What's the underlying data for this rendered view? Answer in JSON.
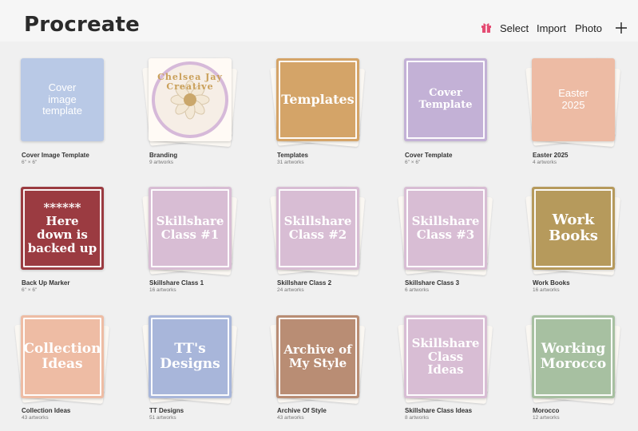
{
  "app": {
    "title": "Procreate"
  },
  "toolbar": {
    "gift_icon": "gift-icon",
    "select_label": "Select",
    "import_label": "Import",
    "photo_label": "Photo",
    "add_icon": "plus-icon"
  },
  "gallery": {
    "items": [
      {
        "name": "Cover Image Template",
        "meta": "6\" × 6\"",
        "cover_text": "Cover\nimage\ntemplate",
        "color": "#b9c9e6",
        "kind": "single"
      },
      {
        "name": "Branding",
        "meta": "9 artworks",
        "cover_text": "Chelsea Jay\nCreative",
        "color": "#f6eee6",
        "kind": "stack"
      },
      {
        "name": "Templates",
        "meta": "31 artworks",
        "cover_text": "Templates",
        "color": "#d4a468",
        "kind": "stack"
      },
      {
        "name": "Cover Template",
        "meta": "6\" × 6\"",
        "cover_text": "Cover\nTemplate",
        "color": "#c3b1d6",
        "kind": "single"
      },
      {
        "name": "Easter 2025",
        "meta": "4 artworks",
        "cover_text": "Easter\n2025",
        "color": "#edbba4",
        "kind": "stack"
      },
      {
        "name": "Back Up Marker",
        "meta": "6\" × 6\"",
        "cover_text": "******\nHere\ndown is\nbacked up",
        "color": "#9b3b41",
        "kind": "single"
      },
      {
        "name": "Skillshare Class 1",
        "meta": "16 artworks",
        "cover_text": "Skillshare\nClass #1",
        "color": "#d8bdd4",
        "kind": "stack"
      },
      {
        "name": "Skillshare Class 2",
        "meta": "24 artworks",
        "cover_text": "Skillshare\nClass #2",
        "color": "#d8bdd4",
        "kind": "stack"
      },
      {
        "name": "Skillshare Class 3",
        "meta": "6 artworks",
        "cover_text": "Skillshare\nClass #3",
        "color": "#d8bdd4",
        "kind": "stack"
      },
      {
        "name": "Work Books",
        "meta": "16 artworks",
        "cover_text": "Work\nBooks",
        "color": "#b69a5c",
        "kind": "stack"
      },
      {
        "name": "Collection Ideas",
        "meta": "43 artworks",
        "cover_text": "Collection\nIdeas",
        "color": "#eebca4",
        "kind": "stack"
      },
      {
        "name": "TT Designs",
        "meta": "51 artworks",
        "cover_text": "TT's\nDesigns",
        "color": "#a8b6da",
        "kind": "stack"
      },
      {
        "name": "Archive Of Style",
        "meta": "43 artworks",
        "cover_text": "Archive of\nMy Style",
        "color": "#b98d74",
        "kind": "stack"
      },
      {
        "name": "Skillshare Class Ideas",
        "meta": "8 artworks",
        "cover_text": "Skillshare\nClass\nIdeas",
        "color": "#d8bdd4",
        "kind": "stack"
      },
      {
        "name": "Morocco",
        "meta": "12 artworks",
        "cover_text": "Working\nMorocco",
        "color": "#a7c0a1",
        "kind": "stack"
      }
    ]
  }
}
